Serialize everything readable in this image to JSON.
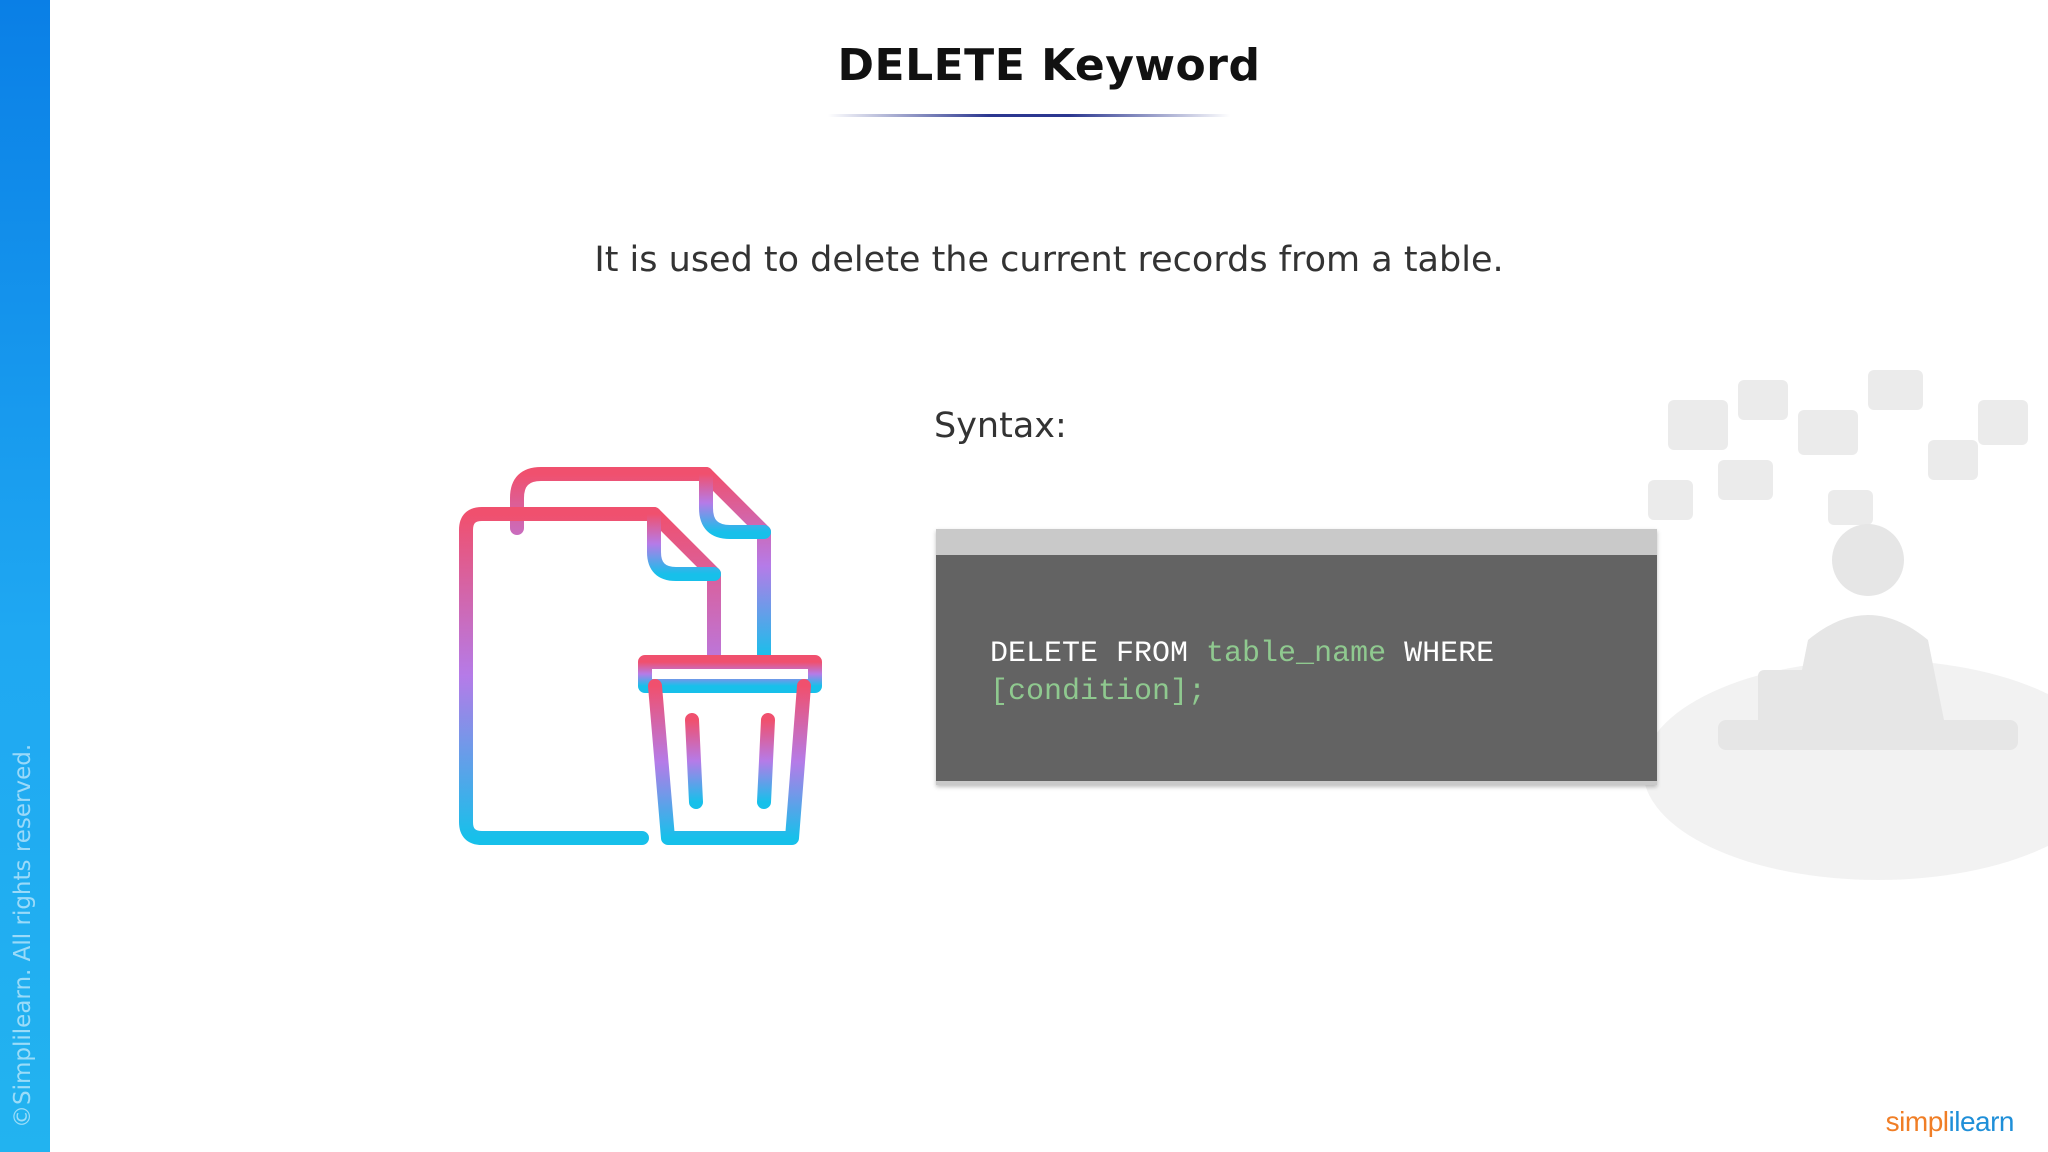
{
  "slide": {
    "title": "DELETE Keyword",
    "description": "It is used to delete the current records from a table.",
    "syntax_label": "Syntax:",
    "copyright": "©Simplilearn. All rights reserved."
  },
  "code": {
    "keyword_1": "DELETE FROM ",
    "placeholder_1": "table_name",
    "keyword_2": " WHERE",
    "placeholder_2": "[condition];"
  },
  "brand": {
    "logo_part_1": "simpl",
    "logo_part_2": "ilearn"
  },
  "icons": {
    "main_illustration": "document-trash-icon",
    "background_illustration": "person-at-desk-illustration"
  },
  "colors": {
    "accent_bar": "#1fa8f2",
    "title_underline": "#2b3790",
    "code_background": "#636363",
    "code_placeholder": "#8fc98f",
    "icon_gradient_top": "#f0506e",
    "icon_gradient_mid": "#b57be8",
    "icon_gradient_bottom": "#17c0ea",
    "brand_orange": "#f07e26",
    "brand_blue": "#1f8fd8"
  }
}
